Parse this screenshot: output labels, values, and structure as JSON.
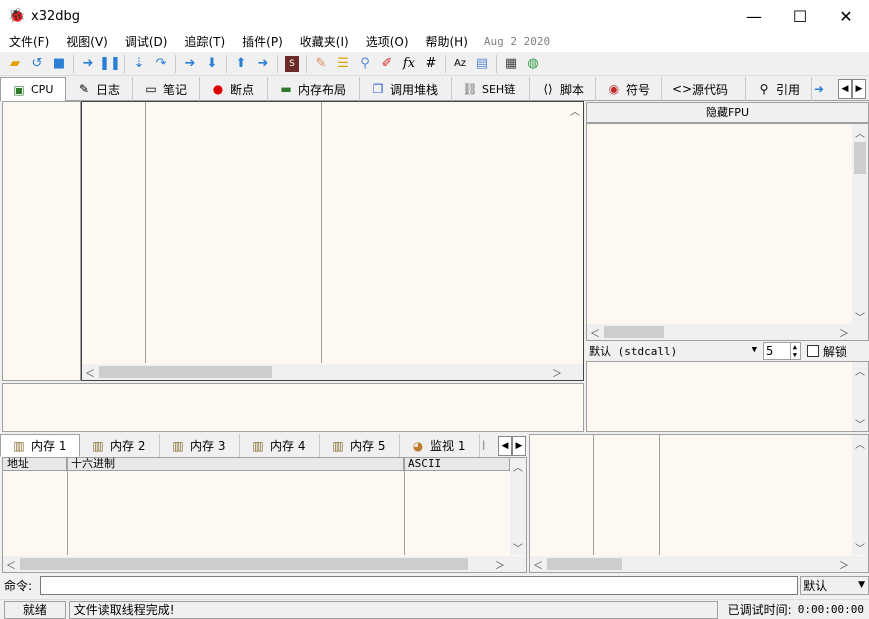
{
  "window": {
    "title": "x32dbg",
    "minimize": "—",
    "maximize": "☐",
    "close": "✕"
  },
  "menu": {
    "items": [
      "文件(F)",
      "视图(V)",
      "调试(D)",
      "追踪(T)",
      "插件(P)",
      "收藏夹(I)",
      "选项(O)",
      "帮助(H)"
    ],
    "build_date": "Aug 2 2020"
  },
  "toolbar_icons": [
    "open-folder-icon",
    "restart-icon",
    "stop-icon",
    "run-icon",
    "pause-icon",
    "step-into-icon",
    "step-over-icon",
    "trace-into-icon",
    "trace-over-icon",
    "execute-till-return-icon",
    "run-to-user-code-icon",
    "scylla-icon",
    "patch-icon",
    "comment-icon",
    "label-icon",
    "bookmark-icon",
    "function-icon",
    "hash-icon",
    "font-icon",
    "script-icon",
    "calculator-icon",
    "globe-icon"
  ],
  "tabs": [
    {
      "label": "CPU",
      "icon": "cpu-icon",
      "active": true
    },
    {
      "label": "日志",
      "icon": "log-icon"
    },
    {
      "label": "笔记",
      "icon": "notes-icon"
    },
    {
      "label": "断点",
      "icon": "breakpoint-icon"
    },
    {
      "label": "内存布局",
      "icon": "memory-map-icon"
    },
    {
      "label": "调用堆栈",
      "icon": "call-stack-icon"
    },
    {
      "label": "SEH链",
      "icon": "seh-icon"
    },
    {
      "label": "脚本",
      "icon": "script-tab-icon"
    },
    {
      "label": "符号",
      "icon": "symbols-icon"
    },
    {
      "label": "源代码",
      "icon": "source-icon"
    },
    {
      "label": "引用",
      "icon": "references-icon"
    }
  ],
  "registers": {
    "hide_fpu": "隐藏FPU"
  },
  "callconv": {
    "selected": "默认 (stdcall)",
    "arg_count": "5",
    "unwind_label": "解锁"
  },
  "dump_tabs": [
    {
      "label": "内存 1",
      "active": true
    },
    {
      "label": "内存 2"
    },
    {
      "label": "内存 3"
    },
    {
      "label": "内存 4"
    },
    {
      "label": "内存 5"
    },
    {
      "label": "监视 1"
    },
    {
      "label": "l"
    }
  ],
  "dump": {
    "columns": [
      "地址",
      "十六进制",
      "ASCII"
    ]
  },
  "command": {
    "label": "命令:",
    "value": "",
    "mode": "默认"
  },
  "status": {
    "state": "就绪",
    "message": "文件读取线程完成!",
    "debug_time_label": "已调试时间:",
    "debug_time": "0:00:00:00"
  }
}
